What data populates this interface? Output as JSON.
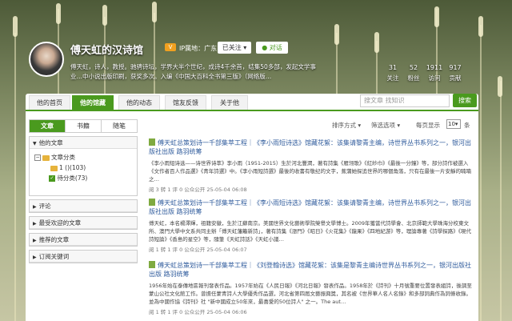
{
  "profile": {
    "name": "傅天虹的汉诗馆",
    "badge": "V",
    "ip_location": "IP属地：广东",
    "follow_label": "已关注",
    "follow_caret": "▾",
    "chat_label": "对话",
    "chat_icon": "●",
    "bio_line1": "傅天虹，诗人，教授。驰骋诗坛，学界大半个世纪，成诗4千余首，结集50多部，发起文学事",
    "bio_line2": "业…中小说出版印刷，获奖多次。入编《中国大百科全书第三版》（网络版…"
  },
  "stats": [
    {
      "num": "31",
      "label": "关注"
    },
    {
      "num": "52",
      "label": "粉丝"
    },
    {
      "num": "1911",
      "label": "访问"
    },
    {
      "num": "917",
      "label": "贡献"
    }
  ],
  "nav": {
    "tabs": [
      "他的首页",
      "他的馆藏",
      "他的动态",
      "馆友反馈",
      "关于他"
    ],
    "search_placeholder": "搜文章 找知识",
    "search_button": "搜索"
  },
  "sidebar": {
    "tabs": [
      "文章",
      "书籍",
      "随笔"
    ],
    "my_articles": "他的文章",
    "category_root": "文章分类",
    "categories": [
      {
        "label": "1 ()",
        "count": "(103)"
      },
      {
        "label": "待分类",
        "count": "(73)"
      }
    ],
    "check_mark": "✓",
    "collapse_mark": "−",
    "expanded_arrow": "▼",
    "collapsed_arrow": "▶",
    "sections": [
      "评论",
      "最受欢迎的文章",
      "推荐的文章",
      "订阅关键词"
    ]
  },
  "filters": {
    "sort": "排序方式",
    "sort_caret": "▾",
    "filter": "筛选选项",
    "filter_caret": "▾",
    "page_label": "每页显示",
    "page_value": "10",
    "page_caret": "▾",
    "page_unit": "条"
  },
  "articles": [
    {
      "title": "傅天虹总策划诗一千部集萃工程｜《李小雨短诗选》馆藏花絮：该集请黎青主编，诗世界丛书系列之一，银河出版社出版 路羽统筹",
      "body": "《李小雨短诗选——诗世界诗萃》李小雨（1951-2015）生於河北豐潤，著有詩集《雁翎歌》《紅紗巾》《最後一分鐘》等，部分詩作被選入《文作者百人作品選》《青年詩選》中。《李小雨短詩選》最後的收書有敬纪的文字，蕉蒲她探追世界的哪個角落，只有在最後一片安靜的喃喃之…",
      "meta": "阅 3  转 1  评 0  公众公开  25-05-04 06:08"
    },
    {
      "title": "傅天虹总策划诗一千部集萃工程｜《李小雨短诗选》馆藏花絮：该集请黎青主编，诗世界丛书系列之一，银河出版社出版 路羽统筹",
      "body": "傅天虹，本名楊澤輝，祖籍安徽，生於江蘇南京。美國世界文化藝術學院榮譽文學博士。2009年獲當代詩學會、北京師範大學珠海分校東文所、澳門大學中文系共同主辦「傅天虹藩籬新詩」，著有詩集《漲門》《昭日》《火花集》《龍果》《四地紀游》等，理論專著《詩學探路》《現代詩短論》《香島的星空》等，隨筆《天虹詩話》《天虹小議…",
      "meta": "阅 1  转 1  评 0  公众公开  25-05-04 06:07"
    },
    {
      "title": "傅天虹总策划诗一千部集萃工程｜《刘登翰诗选》馆藏花絮：该集是黎青主编诗世界丛书系列之一，银河出版社出版 路羽统筹",
      "body": "1956年始在泰傳地區報刊發表作品。1957年始在《人民日報》《河北日報》發表作品。1958年於《詩刊》十月號重要位置發表組詩，後調至蒙山公社文化館工作。曾擔任蒙青詩人大學優秀作品選，河北省第四屆文藝振興獎，其名被《世界華人名人名錄》和多部詞典作為詞條收錄。並為中國作協《詩刊》社 \"新中國成立50年來，最喜愛的50位詩人\" 之一。The aut…",
      "meta": "阅 1  转 1  评 0  公众公开  25-05-04 06:06"
    }
  ]
}
